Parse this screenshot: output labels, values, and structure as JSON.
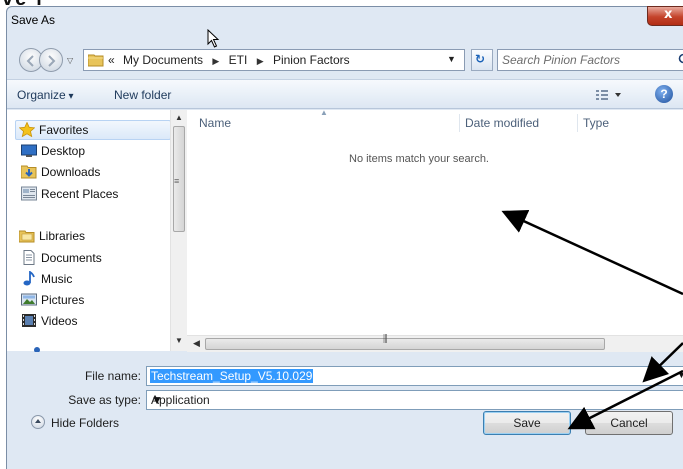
{
  "window": {
    "title": "Save As",
    "close_label": "x"
  },
  "address": {
    "crumbs": [
      "My Documents",
      "ETI",
      "Pinion Factors"
    ],
    "overflow": "«"
  },
  "search": {
    "placeholder": "Search Pinion Factors"
  },
  "toolbar": {
    "organize_label": "Organize",
    "new_folder_label": "New folder",
    "help_label": "?"
  },
  "nav": {
    "items": [
      {
        "label": "Favorites",
        "icon": "star-icon"
      },
      {
        "label": "Desktop",
        "icon": "desktop-icon"
      },
      {
        "label": "Downloads",
        "icon": "downloads-icon"
      },
      {
        "label": "Recent Places",
        "icon": "recent-places-icon"
      },
      {
        "label": "Libraries",
        "icon": "libraries-icon"
      },
      {
        "label": "Documents",
        "icon": "documents-icon"
      },
      {
        "label": "Music",
        "icon": "music-icon"
      },
      {
        "label": "Pictures",
        "icon": "pictures-icon"
      },
      {
        "label": "Videos",
        "icon": "videos-icon"
      }
    ]
  },
  "content": {
    "columns": [
      "Name",
      "Date modified",
      "Type"
    ],
    "empty_message": "No items match your search."
  },
  "form": {
    "filename_label": "File name:",
    "filename_value": "Techstream_Setup_V5.10.029",
    "filetype_label": "Save as type:",
    "filetype_value": "Application"
  },
  "footer": {
    "hide_folders_label": "Hide Folders",
    "save_label": "Save",
    "cancel_label": "Cancel"
  },
  "colors": {
    "selection": "#3399ff",
    "close_button": "#c4432b",
    "annotation_arrow": "#000000"
  }
}
